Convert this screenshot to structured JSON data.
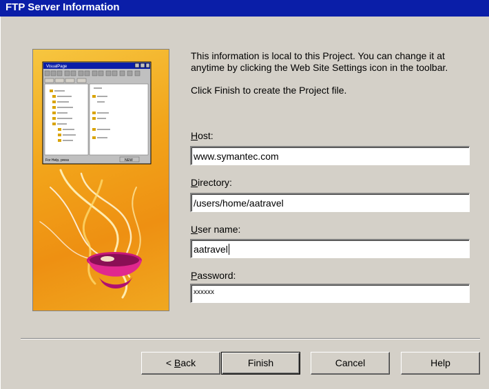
{
  "window": {
    "title": "FTP Server Information"
  },
  "description": {
    "paragraph1": "This information is local to this Project.  You can change it at anytime by clicking the Web Site Settings icon in the toolbar.",
    "paragraph2": "Click Finish to create the Project file."
  },
  "fields": {
    "host": {
      "label_mnemonic": "H",
      "label_rest": "ost:",
      "value": "www.symantec.com"
    },
    "directory": {
      "label_mnemonic": "D",
      "label_rest": "irectory:",
      "value": "/users/home/aatravel"
    },
    "username": {
      "label_mnemonic": "U",
      "label_rest": "ser name:",
      "value": "aatravel"
    },
    "password": {
      "label_mnemonic": "P",
      "label_rest": "assword:",
      "value": "xxxxxx"
    }
  },
  "buttons": {
    "back_prefix": "< ",
    "back_mnemonic": "B",
    "back_rest": "ack",
    "finish": "Finish",
    "cancel": "Cancel",
    "help": "Help"
  },
  "illustration": {
    "app_title": "VisualPage",
    "status_text": "For Help, press",
    "status_mode": "NEW"
  }
}
